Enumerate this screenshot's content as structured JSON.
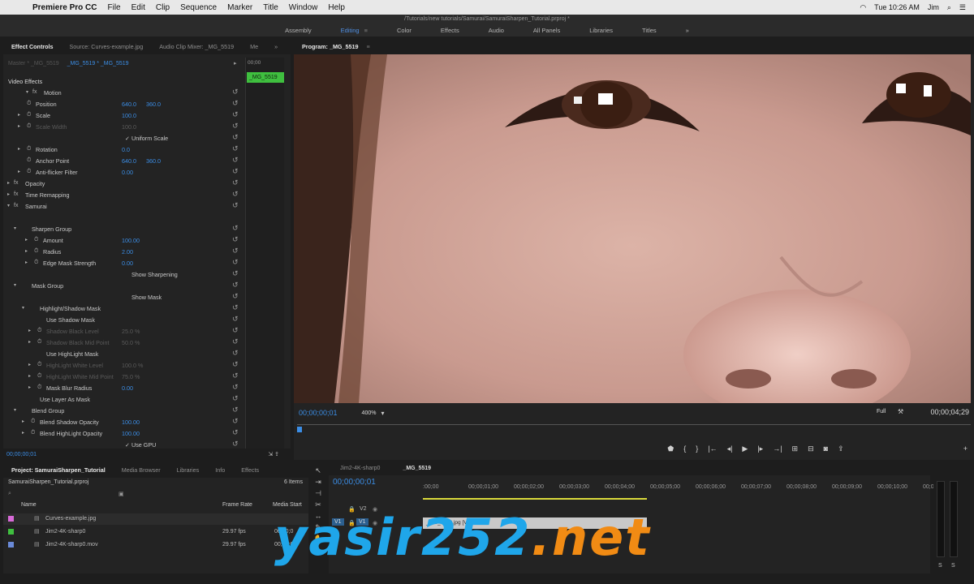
{
  "menubar": {
    "app": "Premiere Pro CC",
    "items": [
      "File",
      "Edit",
      "Clip",
      "Sequence",
      "Marker",
      "Title",
      "Window",
      "Help"
    ],
    "status": {
      "time": "Tue 10:26 AM",
      "user": "Jim"
    }
  },
  "window_title": "/Tutorials/new tutorials/Samurai/SamuraiSharpen_Tutorial.prproj *",
  "workspaces": [
    "Assembly",
    "Editing",
    "Color",
    "Effects",
    "Audio",
    "All Panels",
    "Libraries",
    "Titles"
  ],
  "active_workspace": "Editing",
  "effect_controls": {
    "tabs": [
      "Effect Controls",
      "Source: Curves-example.jpg",
      "Audio Clip Mixer: _MG_5519",
      "Me"
    ],
    "master": "Master * _MG_5519",
    "clip": "_MG_5519 * _MG_5519",
    "ruler_time": "00;00",
    "clip_bar_label": "_MG_5519",
    "timecode": "00;00;00;01",
    "rows": [
      {
        "label": "Video Effects",
        "indent": 6,
        "head": true
      },
      {
        "label": "Motion",
        "indent": 50,
        "tw": "▾",
        "fx": true
      },
      {
        "label": "Position",
        "indent": 40,
        "sw": true,
        "v1": "640.0",
        "v2": "360.0"
      },
      {
        "label": "Scale",
        "indent": 40,
        "tw": "▸",
        "sw": true,
        "v1": "100.0"
      },
      {
        "label": "Scale Width",
        "indent": 40,
        "tw": "▸",
        "sw": true,
        "v1": "100.0",
        "dim": true
      },
      {
        "label": "✓ Uniform Scale",
        "indent": 150
      },
      {
        "label": "Rotation",
        "indent": 40,
        "tw": "▸",
        "sw": true,
        "v1": "0.0"
      },
      {
        "label": "Anchor Point",
        "indent": 40,
        "sw": true,
        "v1": "640.0",
        "v2": "360.0"
      },
      {
        "label": "Anti-flicker Filter",
        "indent": 40,
        "tw": "▸",
        "sw": true,
        "v1": "0.00"
      },
      {
        "label": "Opacity",
        "indent": 27,
        "tw": "▸",
        "fx": true
      },
      {
        "label": "Time Remapping",
        "indent": 27,
        "tw": "▸",
        "fx": true
      },
      {
        "label": "Samurai",
        "indent": 27,
        "tw": "▾",
        "fx": true
      },
      {
        "label": "",
        "indent": 0
      },
      {
        "label": "Sharpen Group",
        "indent": 35,
        "tw": "▾"
      },
      {
        "label": "Amount",
        "indent": 49,
        "tw": "▸",
        "sw": true,
        "v1": "100.00"
      },
      {
        "label": "Radius",
        "indent": 49,
        "tw": "▸",
        "sw": true,
        "v1": "2.00"
      },
      {
        "label": "Edge Mask Strength",
        "indent": 49,
        "tw": "▸",
        "sw": true,
        "v1": "0.00"
      },
      {
        "label": "Show Sharpening",
        "indent": 158
      },
      {
        "label": "Mask Group",
        "indent": 35,
        "tw": "▾"
      },
      {
        "label": "Show Mask",
        "indent": 158
      },
      {
        "label": "Highlight/Shadow Mask",
        "indent": 45,
        "tw": "▾"
      },
      {
        "label": "Use Shadow Mask",
        "indent": 53
      },
      {
        "label": "Shadow Black Level",
        "indent": 53,
        "tw": "▸",
        "sw": true,
        "v1": "25.0 %",
        "dim": true
      },
      {
        "label": "Shadow Black Mid Point",
        "indent": 53,
        "tw": "▸",
        "sw": true,
        "v1": "50.0 %",
        "dim": true
      },
      {
        "label": "Use HighLight Mask",
        "indent": 53
      },
      {
        "label": "HighLight White Level",
        "indent": 53,
        "tw": "▸",
        "sw": true,
        "v1": "100.0 %",
        "dim": true
      },
      {
        "label": "HighLight White Mid Point",
        "indent": 53,
        "tw": "▸",
        "sw": true,
        "v1": "75.0 %",
        "dim": true
      },
      {
        "label": "Mask Blur Radius",
        "indent": 53,
        "tw": "▸",
        "sw": true,
        "v1": "0.00"
      },
      {
        "label": "Use Layer As Mask",
        "indent": 45
      },
      {
        "label": "Blend Group",
        "indent": 35,
        "tw": "▾"
      },
      {
        "label": "Blend Shadow Opacity",
        "indent": 45,
        "tw": "▸",
        "sw": true,
        "v1": "100.00"
      },
      {
        "label": "Blend HighLight Opacity",
        "indent": 45,
        "tw": "▸",
        "sw": true,
        "v1": "100.00"
      },
      {
        "label": "✓ Use GPU",
        "indent": 150
      }
    ]
  },
  "program": {
    "title": "Program: _MG_5519",
    "timecode": "00;00;00;01",
    "zoom": "400%",
    "quality": "Full",
    "duration": "00;00;04;29"
  },
  "project": {
    "tabs": [
      "Project: SamuraiSharpen_Tutorial",
      "Media Browser",
      "Libraries",
      "Info",
      "Effects"
    ],
    "file": "SamuraiSharpen_Tutorial.prproj",
    "count": "6 Items",
    "columns": [
      "Name",
      "Frame Rate",
      "Media Start"
    ],
    "items": [
      {
        "name": "Curves-example.jpg",
        "rate": "",
        "start": "",
        "color": "#d86ad8"
      },
      {
        "name": "Jim2-4K-sharp0",
        "rate": "29.97 fps",
        "start": "00;00;0",
        "color": "#3fbf3f"
      },
      {
        "name": "Jim2-4K-sharp0.mov",
        "rate": "29.97 fps",
        "start": "00;00;0",
        "color": "#6a8ad8"
      }
    ]
  },
  "timeline": {
    "tabs": [
      "Jim2-4K-sharp0",
      "_MG_5519"
    ],
    "timecode": "00;00;00;01",
    "ruler": [
      ":00;00",
      "00;00;01;00",
      "00;00;02;00",
      "00;00;03;00",
      "00;00;04;00",
      "00;00;05;00",
      "00;00;06;00",
      "00;00;07;00",
      "00;00;08;00",
      "00;00;09;00",
      "00;00;10;00",
      "00;0"
    ],
    "clip": "_MG_5519.jpg [V]",
    "tracks": [
      "V2",
      "V1"
    ],
    "v1_left": "V1"
  },
  "meter": {
    "labels": [
      "S",
      "S"
    ]
  },
  "watermark": {
    "part1": "yasir252",
    "part2": ".net"
  }
}
